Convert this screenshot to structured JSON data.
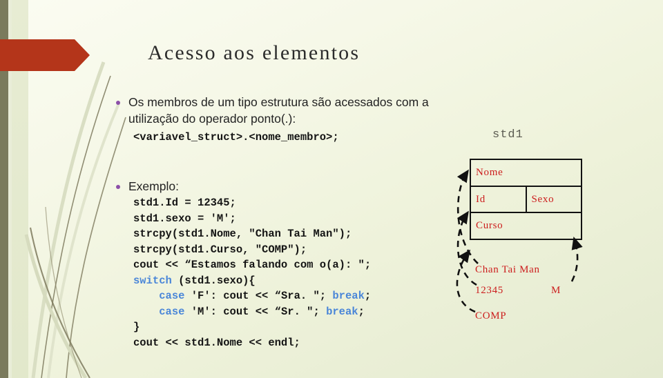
{
  "slide": {
    "title": "Acesso aos elementos",
    "accent_color": "#b4351a",
    "keyword_color": "#4a86d8",
    "diagram_text_color": "#cc1d1d",
    "bullet_color": "#8c4fa8",
    "background_top": "#fbfcf2",
    "background_bottom": "#e4ead0"
  },
  "bullets": [
    {
      "id": "members",
      "text": "Os membros de um tipo estrutura são acessados com a utilização do operador ponto(.):"
    },
    {
      "id": "example",
      "text": "Exemplo:"
    }
  ],
  "struct_declaration": "<variavel_struct>.<nome_membro>;",
  "code": {
    "lines": [
      [
        {
          "t": "std1.Id = 12345;",
          "k": false
        }
      ],
      [
        {
          "t": "std1.sexo = 'M';",
          "k": false
        }
      ],
      [
        {
          "t": "strcpy(std1.Nome, \"Chan Tai Man\");",
          "k": false
        }
      ],
      [
        {
          "t": "strcpy(std1.Curso, \"COMP\");",
          "k": false
        }
      ],
      [
        {
          "t": "cout << “Estamos falando com o(a): \";",
          "k": false
        }
      ],
      [
        {
          "t": "switch",
          "k": true
        },
        {
          "t": " (std1.sexo){",
          "k": false
        }
      ],
      [
        {
          "t": "    ",
          "k": false
        },
        {
          "t": "case",
          "k": true
        },
        {
          "t": " 'F': cout << “Sra. \"; ",
          "k": false
        },
        {
          "t": "break",
          "k": true
        },
        {
          "t": ";",
          "k": false
        }
      ],
      [
        {
          "t": "    ",
          "k": false
        },
        {
          "t": "case",
          "k": true
        },
        {
          "t": " 'M': cout << “Sr. \"; ",
          "k": false
        },
        {
          "t": "break",
          "k": true
        },
        {
          "t": ";",
          "k": false
        }
      ],
      [
        {
          "t": "}",
          "k": false
        }
      ],
      [
        {
          "t": "cout << std1.Nome << endl;",
          "k": false
        }
      ]
    ]
  },
  "diagram": {
    "variable_label": "std1",
    "table": {
      "rows": [
        {
          "cells": [
            "Nome"
          ]
        },
        {
          "cells": [
            "Id",
            "Sexo"
          ]
        },
        {
          "cells": [
            "Curso"
          ]
        }
      ]
    },
    "values": {
      "nome": "Chan Tai Man",
      "id": "12345",
      "sexo": "M",
      "curso": "COMP"
    }
  }
}
